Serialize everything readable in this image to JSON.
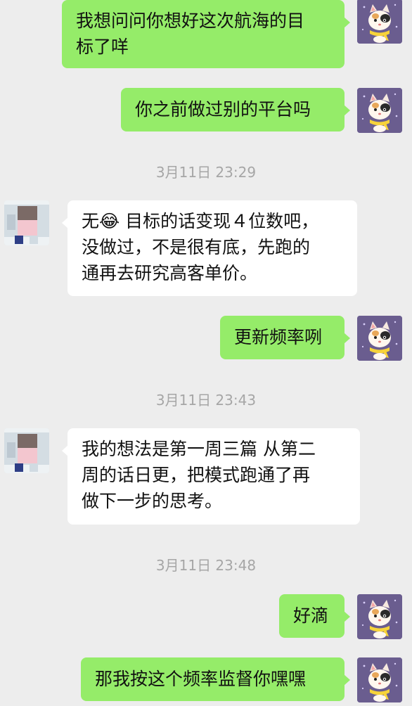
{
  "messages": [
    {
      "lines": [
        "我想问问你想好这次航海的目",
        "标了咩"
      ]
    },
    {
      "lines": [
        "你之前做过别的平台吗"
      ]
    },
    {
      "timestamp": "3月11日 23:29"
    },
    {
      "lines": [
        "无😂 目标的话变现４位数吧，",
        "没做过，不是很有底，先跑的",
        "通再去研究高客单价。"
      ]
    },
    {
      "lines": [
        "更新频率咧"
      ]
    },
    {
      "timestamp": "3月11日 23:43"
    },
    {
      "lines": [
        "我的想法是第一周三篇  从第二",
        "周的话日更，把模式跑通了再",
        "做下一步的思考。"
      ]
    },
    {
      "timestamp": "3月11日 23:48"
    },
    {
      "lines": [
        "好滴"
      ]
    },
    {
      "lines": [
        "那我按这个频率监督你嘿嘿"
      ]
    }
  ],
  "colors": {
    "sent_bubble": "#95ec69",
    "received_bubble": "#ffffff",
    "background": "#ededed",
    "timestamp_text": "#a6a6a6"
  },
  "icons": {
    "me_avatar": "cat-avatar-icon",
    "other_avatar": "blurred-avatar-icon"
  }
}
